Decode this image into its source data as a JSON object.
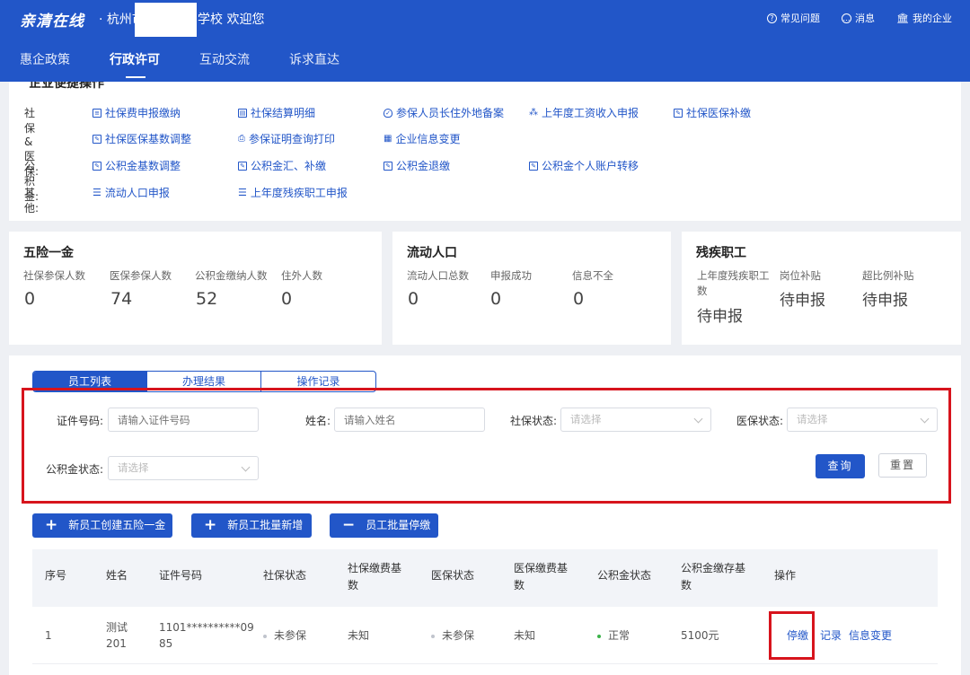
{
  "header": {
    "brand": "亲清在线",
    "welcome_city": "· 杭州市",
    "welcome_school": "学校 欢迎您",
    "links": [
      {
        "label": "常见问题",
        "icon": "help-icon"
      },
      {
        "label": "消息",
        "icon": "message-icon"
      },
      {
        "label": "我的企业",
        "icon": "building-icon"
      }
    ],
    "nav": [
      "惠企政策",
      "行政许可",
      "互动交流",
      "诉求直达"
    ],
    "active_nav": "行政许可"
  },
  "quick": {
    "title": "企业便捷操作",
    "rows": [
      {
        "label": "社保&医保:",
        "links": [
          "社保费申报缴纳",
          "社保结算明细",
          "参保人员长住外地备案",
          "上年度工资收入申报",
          "社保医保补缴"
        ]
      },
      {
        "label": "",
        "links": [
          "社保医保基数调整",
          "参保证明查询打印",
          "企业信息变更"
        ]
      },
      {
        "label": "公积金:",
        "links": [
          "公积金基数调整",
          "公积金汇、补缴",
          "公积金退缴",
          "公积金个人账户转移"
        ]
      },
      {
        "label": "其他:",
        "links": [
          "流动人口申报",
          "上年度残疾职工申报"
        ]
      }
    ]
  },
  "stats": [
    {
      "title": "五险一金",
      "items": [
        {
          "label": "社保参保人数",
          "value": "0"
        },
        {
          "label": "医保参保人数",
          "value": "74"
        },
        {
          "label": "公积金缴纳人数",
          "value": "52"
        },
        {
          "label": "住外人数",
          "value": "0"
        }
      ]
    },
    {
      "title": "流动人口",
      "items": [
        {
          "label": "流动人口总数",
          "value": "0"
        },
        {
          "label": "申报成功",
          "value": "0"
        },
        {
          "label": "信息不全",
          "value": "0"
        }
      ]
    },
    {
      "title": "残疾职工",
      "items": [
        {
          "label_line1": "上年度残疾职工",
          "label_line2": "数",
          "value": "待申报"
        },
        {
          "label": "岗位补贴",
          "value": "待申报"
        },
        {
          "label": "超比例补贴",
          "value": "待申报"
        }
      ]
    }
  ],
  "tabs": [
    "员工列表",
    "办理结果",
    "操作记录"
  ],
  "filters": {
    "id_label": "证件号码:",
    "id_placeholder": "请输入证件号码",
    "name_label": "姓名:",
    "name_placeholder": "请输入姓名",
    "ss_label": "社保状态:",
    "ss_placeholder": "请选择",
    "mi_label": "医保状态:",
    "mi_placeholder": "请选择",
    "hf_label": "公积金状态:",
    "hf_placeholder": "请选择",
    "query": "查询",
    "reset": "重置"
  },
  "actions": [
    "新员工创建五险一金",
    "新员工批量新增",
    "员工批量停缴"
  ],
  "table": {
    "headers": [
      {
        "l1": "序号",
        "l2": ""
      },
      {
        "l1": "姓名",
        "l2": ""
      },
      {
        "l1": "证件号码",
        "l2": ""
      },
      {
        "l1": "社保状态",
        "l2": ""
      },
      {
        "l1": "社保缴费基",
        "l2": "数"
      },
      {
        "l1": "医保状态",
        "l2": ""
      },
      {
        "l1": "医保缴费基",
        "l2": "数"
      },
      {
        "l1": "公积金状态",
        "l2": ""
      },
      {
        "l1": "公积金缴存基",
        "l2": "数"
      },
      {
        "l1": "操作",
        "l2": ""
      }
    ],
    "row": {
      "index": "1",
      "name1": "测试",
      "name2": "201",
      "id1": "1101**********09",
      "id2": "85",
      "ss_status": "未参保",
      "ss_base": "未知",
      "mi_status": "未参保",
      "mi_base": "未知",
      "hf_status": "正常",
      "hf_base": "5100元",
      "ops": [
        "停缴",
        "记录",
        "信息变更"
      ]
    }
  },
  "colors": {
    "primary": "#2256c8",
    "highlight": "#d7141d",
    "ok": "#3cb34a",
    "grey_dot": "#c0c4cc"
  }
}
